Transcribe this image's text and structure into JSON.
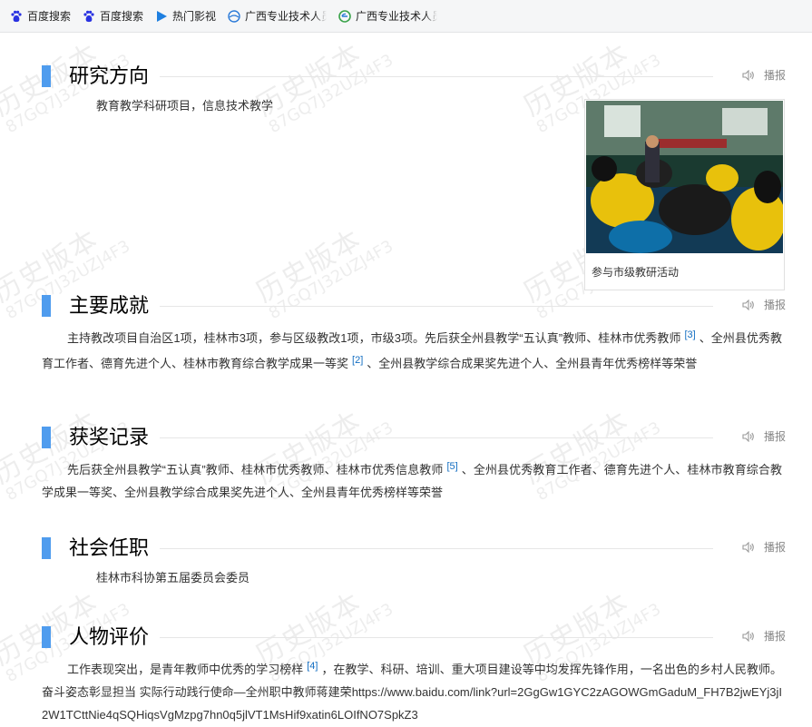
{
  "bookmarks": [
    {
      "label": "百度搜索",
      "icon": "baidu-paw-icon"
    },
    {
      "label": "百度搜索",
      "icon": "baidu-paw-icon"
    },
    {
      "label": "热门影视",
      "icon": "video-play-icon"
    },
    {
      "label": "广西专业技术人员",
      "icon": "globe-icon"
    },
    {
      "label": "广西专业技术人员",
      "icon": "browser-e-icon"
    }
  ],
  "watermark": {
    "line1": "历史版本",
    "line2": "87GQ7J32UZJ4F3"
  },
  "play_label": "播报",
  "photo": {
    "caption": "参与市级教研活动"
  },
  "sections": {
    "research": {
      "title": "研究方向",
      "text": "教育教学科研项目，信息技术教学"
    },
    "achievements": {
      "title": "主要成就",
      "text_a": "主持教改项目自治区1项，桂林市3项，参与区级教改1项，市级3项。先后获全州县教学“五认真”教师、桂林市优秀教师",
      "ref_a": "[3]",
      "text_b": "、全州县优秀教育工作者、德育先进个人、桂林市教育综合教学成果一等奖",
      "ref_b": "[2]",
      "text_c": "、全州县教学综合成果奖先进个人、全州县青年优秀榜样等荣誉"
    },
    "awards": {
      "title": "获奖记录",
      "text_a": "先后获全州县教学“五认真”教师、桂林市优秀教师、桂林市优秀信息教师",
      "ref_a": "[5]",
      "text_b": "、全州县优秀教育工作者、德育先进个人、桂林市教育综合教学成果一等奖、全州县教学综合成果奖先进个人、全州县青年优秀榜样等荣誉"
    },
    "social": {
      "title": "社会任职",
      "text": "桂林市科协第五届委员会委员"
    },
    "evaluation": {
      "title": "人物评价",
      "text_a": "工作表现突出，是青年教师中优秀的学习榜样",
      "ref_a": "[4]",
      "text_b": "，在教学、科研、培训、重大项目建设等中均发挥先锋作用，一名出色的乡村人民教师。奋斗姿态彰显担当 实际行动践行使命—全州职中教师蒋建荣https://www.baidu.com/link?url=2GgGw1GYC2zAGOWGmGaduM_FH7B2jwEYj3jI2W1TCttNie4qSQHiqsVgMzpg7hn0q5jlVT1MsHif9xatin6LOIfNO7SpkZ3"
    }
  }
}
